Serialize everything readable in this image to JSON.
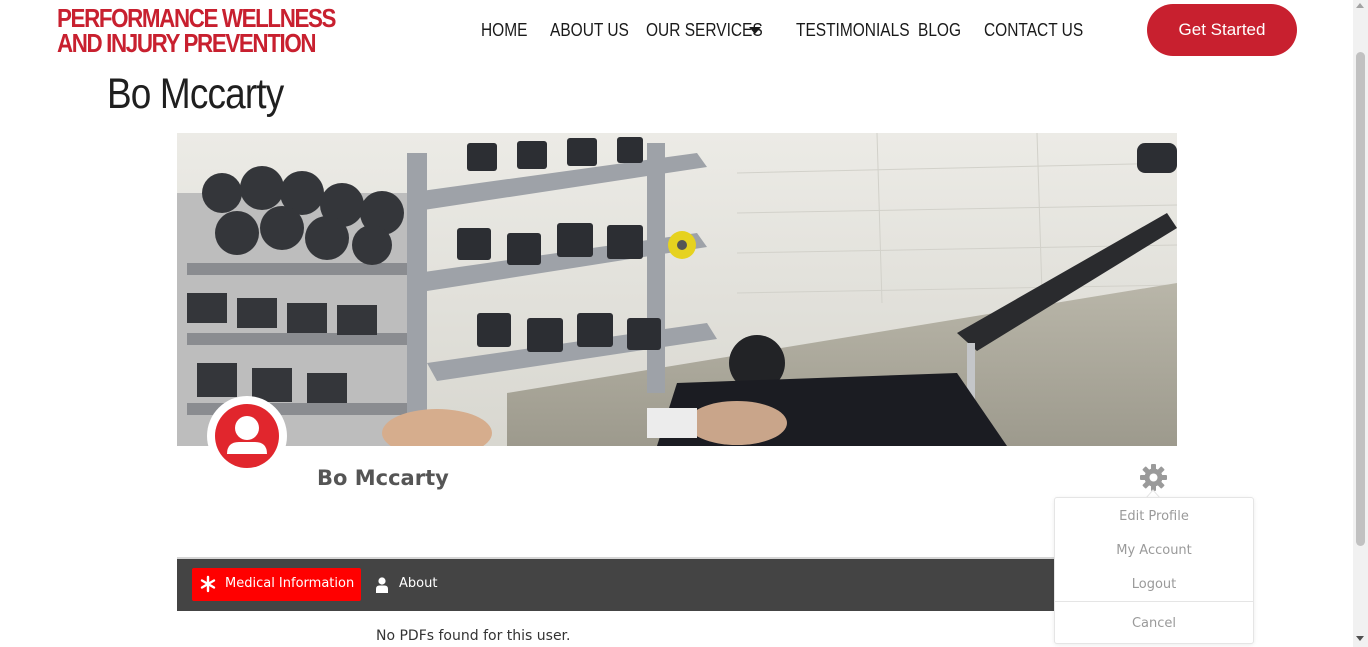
{
  "header": {
    "logo_line1": "PERFORMANCE WELLNESS",
    "logo_line2": "AND INJURY PREVENTION",
    "nav": [
      {
        "label": "HOME"
      },
      {
        "label": "ABOUT US"
      },
      {
        "label": "OUR SERVICES"
      },
      {
        "label": "TESTIMONIALS"
      },
      {
        "label": "BLOG"
      },
      {
        "label": "CONTACT US"
      }
    ],
    "cta_label": "Get Started"
  },
  "page": {
    "title": "Bo Mccarty"
  },
  "profile": {
    "name": "Bo Mccarty",
    "cover_photo": "gym-dumbbell-rack-photo",
    "avatar_icon": "user-circle-icon"
  },
  "profile_menu": {
    "items": [
      {
        "label": "Edit Profile"
      },
      {
        "label": "My Account"
      },
      {
        "label": "Logout"
      }
    ],
    "cancel_label": "Cancel"
  },
  "tabs": {
    "items": [
      {
        "label": "Medical Information",
        "icon": "asterisk-icon",
        "active": true
      },
      {
        "label": "About",
        "icon": "user-icon",
        "active": false
      }
    ]
  },
  "content": {
    "empty_message": "No PDFs found for this user."
  },
  "colors": {
    "brand_red": "#c8202f",
    "tab_active": "#ff0000",
    "avatar_red": "#e1262d",
    "tab_bar": "#444444"
  }
}
